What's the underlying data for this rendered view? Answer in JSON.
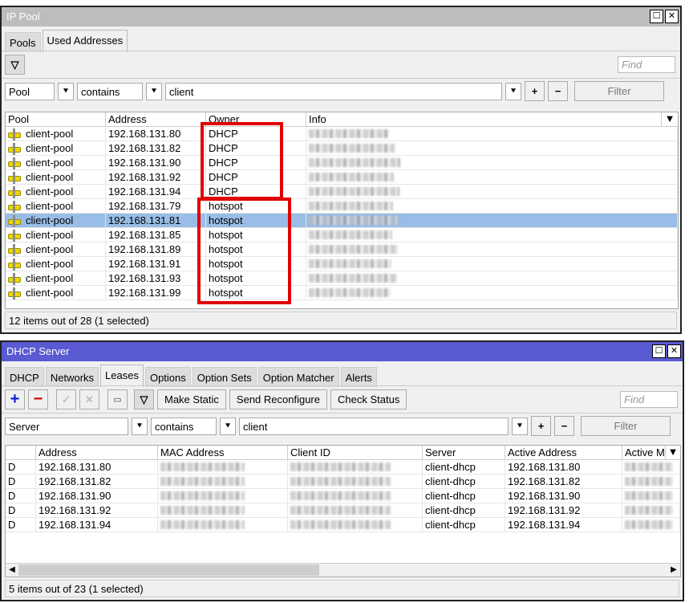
{
  "ip_pool": {
    "title": "IP Pool",
    "tabs": [
      "Pools",
      "Used Addresses"
    ],
    "find_placeholder": "Find",
    "filter": {
      "field": "Pool",
      "op": "contains",
      "value": "client",
      "button": "Filter"
    },
    "columns": [
      "Pool",
      "Address",
      "Owner",
      "Info"
    ],
    "rows": [
      {
        "pool": "client-pool",
        "address": "192.168.131.80",
        "owner": "DHCP"
      },
      {
        "pool": "client-pool",
        "address": "192.168.131.82",
        "owner": "DHCP"
      },
      {
        "pool": "client-pool",
        "address": "192.168.131.90",
        "owner": "DHCP"
      },
      {
        "pool": "client-pool",
        "address": "192.168.131.92",
        "owner": "DHCP"
      },
      {
        "pool": "client-pool",
        "address": "192.168.131.94",
        "owner": "DHCP"
      },
      {
        "pool": "client-pool",
        "address": "192.168.131.79",
        "owner": "hotspot"
      },
      {
        "pool": "client-pool",
        "address": "192.168.131.81",
        "owner": "hotspot",
        "selected": true
      },
      {
        "pool": "client-pool",
        "address": "192.168.131.85",
        "owner": "hotspot"
      },
      {
        "pool": "client-pool",
        "address": "192.168.131.89",
        "owner": "hotspot"
      },
      {
        "pool": "client-pool",
        "address": "192.168.131.91",
        "owner": "hotspot"
      },
      {
        "pool": "client-pool",
        "address": "192.168.131.93",
        "owner": "hotspot"
      },
      {
        "pool": "client-pool",
        "address": "192.168.131.99",
        "owner": "hotspot"
      }
    ],
    "status": "12 items out of 28 (1 selected)"
  },
  "dhcp": {
    "title": "DHCP Server",
    "tabs": [
      "DHCP",
      "Networks",
      "Leases",
      "Options",
      "Option Sets",
      "Option Matcher",
      "Alerts"
    ],
    "buttons": [
      "Make Static",
      "Send Reconfigure",
      "Check Status"
    ],
    "find_placeholder": "Find",
    "filter": {
      "field": "Server",
      "op": "contains",
      "value": "client",
      "button": "Filter"
    },
    "columns": [
      "",
      "Address",
      "MAC Address",
      "Client ID",
      "Server",
      "Active Address",
      "Active M"
    ],
    "rows": [
      {
        "flag": "D",
        "address": "192.168.131.80",
        "server": "client-dhcp",
        "active": "192.168.131.80"
      },
      {
        "flag": "D",
        "address": "192.168.131.82",
        "server": "client-dhcp",
        "active": "192.168.131.82"
      },
      {
        "flag": "D",
        "address": "192.168.131.90",
        "server": "client-dhcp",
        "active": "192.168.131.90"
      },
      {
        "flag": "D",
        "address": "192.168.131.92",
        "server": "client-dhcp",
        "active": "192.168.131.92"
      },
      {
        "flag": "D",
        "address": "192.168.131.94",
        "server": "client-dhcp",
        "active": "192.168.131.94"
      }
    ],
    "status": "5 items out of 23 (1 selected)"
  }
}
